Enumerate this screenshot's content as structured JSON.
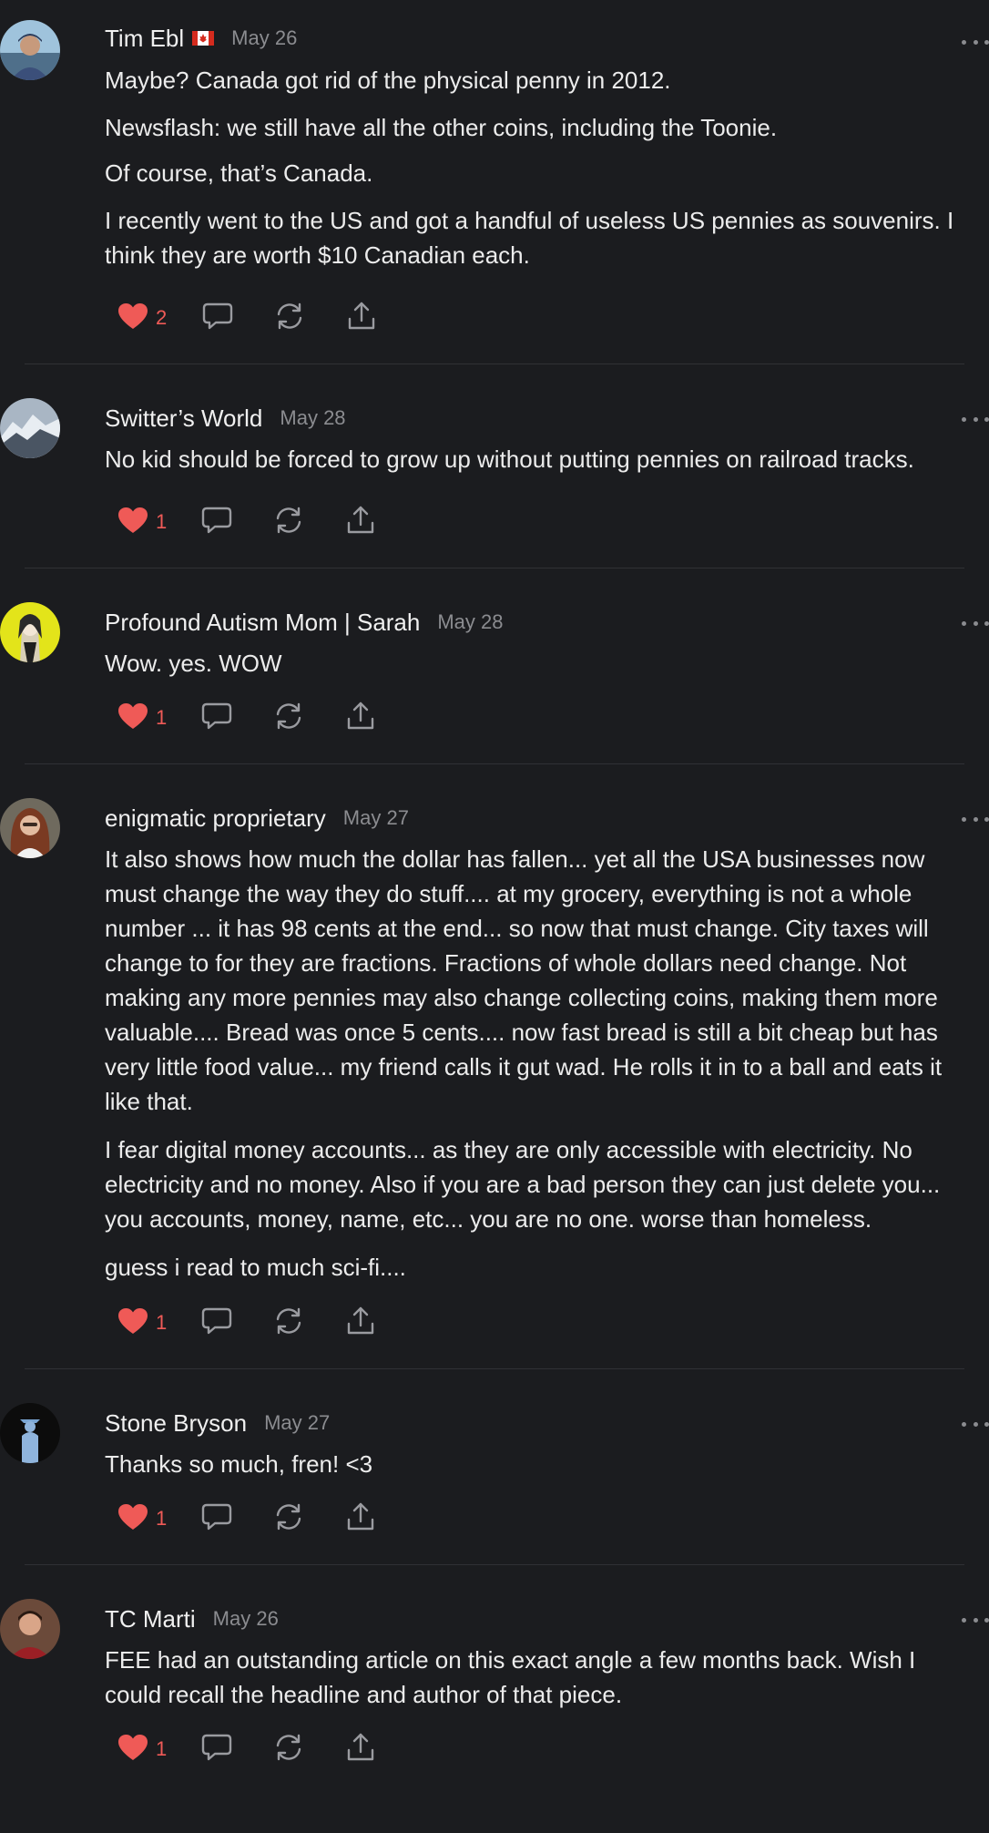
{
  "colors": {
    "background": "#1b1c1f",
    "like": "#ef5a57",
    "muted": "#8b8c90",
    "divider": "#303135"
  },
  "comments": [
    {
      "author": "Tim Ebl",
      "flag": "canada-flag-icon",
      "date": "May 26",
      "paragraphs": [
        "Maybe? Canada got rid of the physical penny in 2012.",
        "Newsflash: we still have all the other coins, including the Toonie.",
        "Of course, that’s Canada.",
        "I recently went to the US and got a handful of useless US pennies as souvenirs. I think they are worth $10 Canadian each."
      ],
      "likes": "2"
    },
    {
      "author": "Switter’s World",
      "date": "May 28",
      "paragraphs": [
        "No kid should be forced to grow up without putting pennies on railroad tracks."
      ],
      "likes": "1"
    },
    {
      "author": "Profound Autism Mom | Sarah",
      "date": "May 28",
      "paragraphs": [
        "Wow. yes. WOW"
      ],
      "likes": "1"
    },
    {
      "author": "enigmatic proprietary",
      "date": "May 27",
      "paragraphs": [
        "It also shows how much the dollar has fallen... yet all the USA businesses now must change the way they do stuff.... at my grocery, everything is not a whole number ... it has 98 cents at the end... so now that must change. City taxes will change to for they are fractions. Fractions of whole dollars need change. Not making any more pennies may also change collecting coins, making them more valuable.... Bread was once 5 cents.... now fast bread is still a bit cheap but has very little food value... my friend calls it gut wad. He rolls it in to a ball and eats it like that.",
        "I fear digital money accounts... as they are only accessible with electricity. No electricity and no money. Also if you are a bad person they can just delete you... you accounts, money, name, etc... you are no one. worse than homeless.",
        "guess i read to much sci-fi...."
      ],
      "likes": "1"
    },
    {
      "author": "Stone Bryson",
      "date": "May 27",
      "paragraphs": [
        "Thanks so much, fren! <3"
      ],
      "likes": "1"
    },
    {
      "author": "TC Marti",
      "date": "May 26",
      "paragraphs": [
        "FEE had an outstanding article on this exact angle a few months back. Wish I could recall the headline and author of that piece."
      ],
      "likes": "1"
    }
  ]
}
